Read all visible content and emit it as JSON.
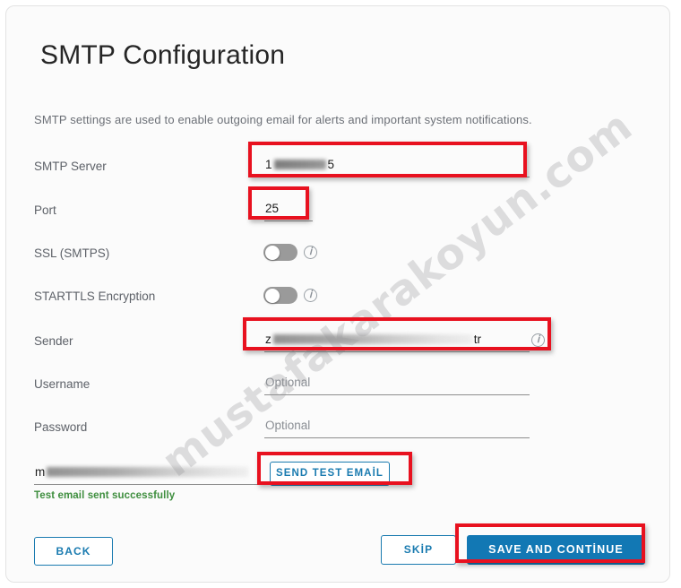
{
  "page": {
    "title": "SMTP Configuration",
    "description": "SMTP settings are used to enable outgoing email for alerts and important system notifications.",
    "watermark": "mustafakarakoyun.com",
    "accent_blue": "#1278b4",
    "annotation_red": "#e8111f",
    "success_green": "#3e8e3e"
  },
  "form": {
    "rows": [
      {
        "label": "SMTP Server",
        "type": "text",
        "value_prefix": "1",
        "value_suffix": "5",
        "redacted": true
      },
      {
        "label": "Port",
        "type": "text",
        "value": "25",
        "redacted": false
      },
      {
        "label": "SSL (SMTPS)",
        "type": "toggle",
        "state": "off",
        "info": true
      },
      {
        "label": "STARTTLS Encryption",
        "type": "toggle",
        "state": "off",
        "info": true
      },
      {
        "label": "Sender",
        "type": "text",
        "value_prefix": "z",
        "value_suffix": "tr",
        "redacted": true,
        "info": true
      },
      {
        "label": "Username",
        "type": "text",
        "placeholder": "Optional",
        "redacted": false
      },
      {
        "label": "Password",
        "type": "text",
        "placeholder": "Optional",
        "redacted": false
      }
    ]
  },
  "test_email": {
    "value_prefix": "m",
    "redacted": true,
    "button_label": "SEND TEST EMAİL",
    "status_message": "Test email sent successfully"
  },
  "footer": {
    "back_label": "BACK",
    "skip_label": "SKİP",
    "save_label": "SAVE AND CONTİNUE"
  },
  "icons": {
    "info": "ⅰ"
  }
}
